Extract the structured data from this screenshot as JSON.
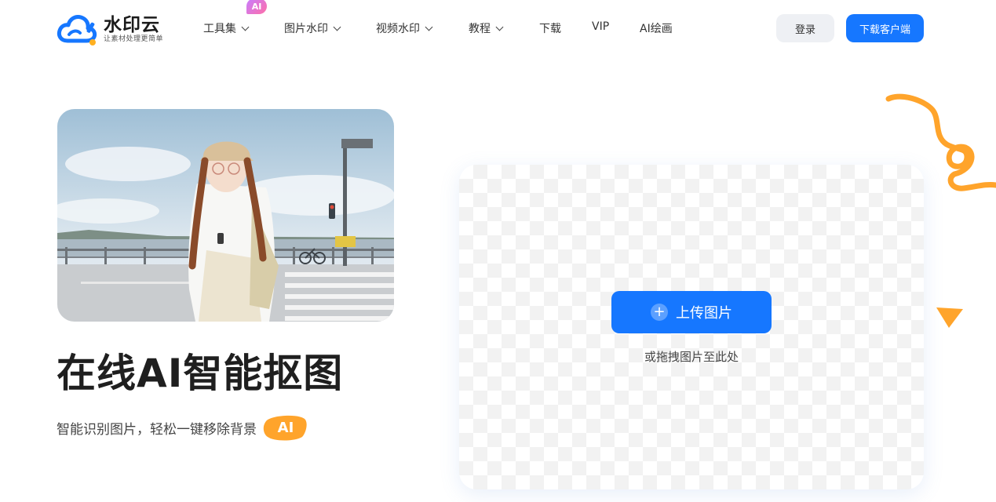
{
  "brand": {
    "name": "水印云",
    "slogan": "让素材处理更简单",
    "logo_colors": [
      "#1677ff",
      "#ffb020"
    ]
  },
  "nav": {
    "items": [
      {
        "label": "工具集",
        "dropdown": true
      },
      {
        "label": "图片水印",
        "dropdown": true
      },
      {
        "label": "视频水印",
        "dropdown": true
      },
      {
        "label": "教程",
        "dropdown": true
      },
      {
        "label": "下载",
        "dropdown": false
      },
      {
        "label": "VIP",
        "dropdown": false
      },
      {
        "label": "AI绘画",
        "dropdown": false
      }
    ],
    "ai_badge": "AI"
  },
  "header": {
    "login_label": "登录",
    "download_label": "下载客户端"
  },
  "hero": {
    "image_icon": "photo-woman-crosswalk",
    "title": "在线AI智能抠图",
    "subtitle": "智能识别图片，轻松一键移除背景",
    "ai_tag": "AI"
  },
  "upload": {
    "button_label": "上传图片",
    "button_icon": "plus-icon",
    "drop_hint": "或拖拽图片至此处"
  },
  "colors": {
    "accent": "#1677ff",
    "orange": "#ffa42b"
  }
}
